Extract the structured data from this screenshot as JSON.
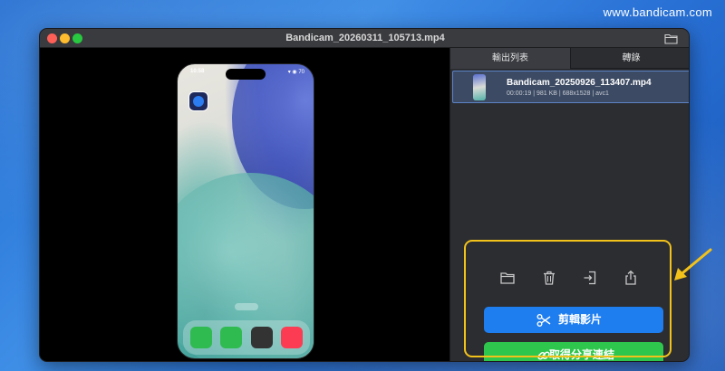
{
  "watermark": "www.bandicam.com",
  "window": {
    "title": "Bandicam_20260311_105713.mp4"
  },
  "preview": {
    "status_time": "10:58",
    "status_right": "▾ ◉ 70"
  },
  "sidebar": {
    "tabs": [
      {
        "label": "輸出列表",
        "active": true
      },
      {
        "label": "轉錄",
        "active": false
      }
    ],
    "files": [
      {
        "name": "Bandicam_20250926_113407.mp4",
        "meta": "00:00:19 | 981 KB | 688x1528 | avc1",
        "selected": true
      }
    ]
  },
  "toolbar": {
    "icons": [
      "folder-icon",
      "trash-icon",
      "import-icon",
      "share-icon"
    ]
  },
  "buttons": {
    "cut_label": "剪輯影片",
    "link_label": "取得分享連結"
  },
  "colors": {
    "accent_blue": "#1e7ef0",
    "accent_green": "#2fc64d",
    "highlight": "#f2c21a",
    "window_bg": "#2b2d31"
  }
}
